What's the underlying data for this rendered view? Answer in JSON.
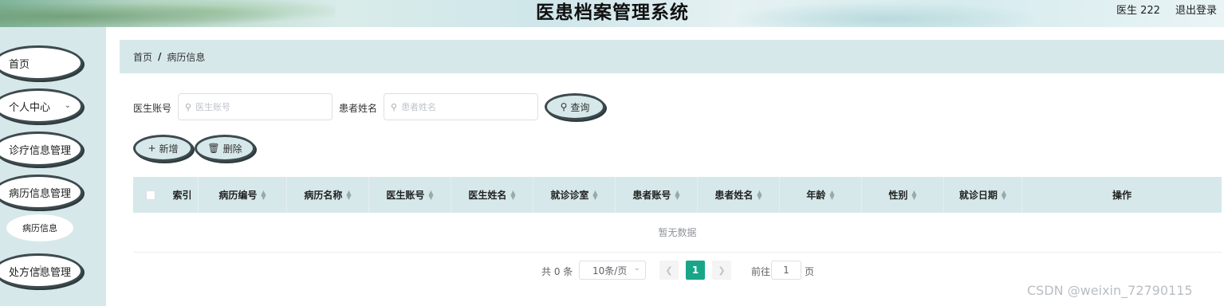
{
  "header": {
    "title": "医患档案管理系统",
    "user": "医生 222",
    "logout": "退出登录"
  },
  "sidebar": {
    "items": [
      {
        "label": "首页"
      },
      {
        "label": "个人中心"
      },
      {
        "label": "诊疗信息管理"
      },
      {
        "label": "病历信息管理"
      },
      {
        "label": "处方信息管理"
      }
    ],
    "expanded_sub_item": "病历信息"
  },
  "breadcrumb": {
    "home": "首页",
    "separator": "/",
    "current": "病历信息"
  },
  "search": {
    "doctor_account_label": "医生账号",
    "doctor_account_placeholder": "医生账号",
    "patient_name_label": "患者姓名",
    "patient_name_placeholder": "患者姓名",
    "query_button": "查询"
  },
  "actions": {
    "add_button": "新增",
    "delete_button": "删除"
  },
  "table": {
    "columns": [
      "索引",
      "病历编号",
      "病历名称",
      "医生账号",
      "医生姓名",
      "就诊诊室",
      "患者账号",
      "患者姓名",
      "年龄",
      "性别",
      "就诊日期",
      "操作"
    ],
    "empty_text": "暂无数据"
  },
  "pagination": {
    "total": "共 0 条",
    "page_size": "10条/页",
    "current_page": "1",
    "goto_label": "前往",
    "goto_value": "1",
    "page_unit": "页"
  },
  "watermark": "CSDN @weixin_72790115",
  "colors": {
    "accent": "#18a689",
    "panel": "#d6e8ea",
    "outline": "#3d4a4e"
  }
}
